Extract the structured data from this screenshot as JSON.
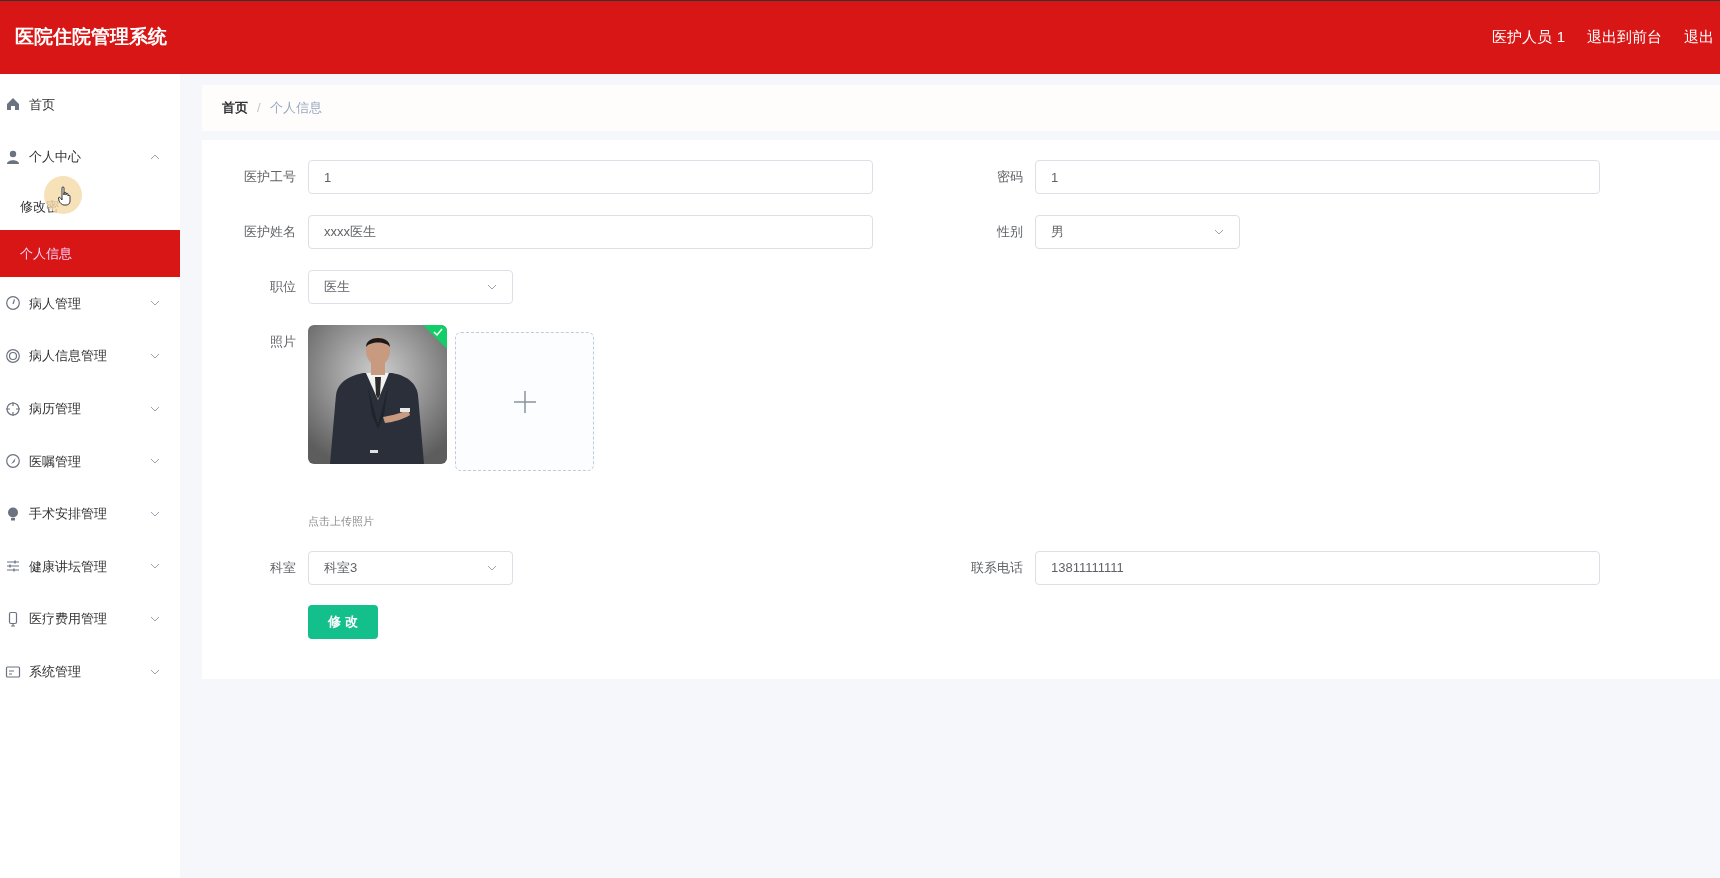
{
  "header": {
    "title": "医院住院管理系统",
    "links": [
      "医护人员 1",
      "退出到前台",
      "退出"
    ]
  },
  "sidebar": {
    "items": [
      {
        "label": "首页"
      },
      {
        "label": "个人中心",
        "expanded": true,
        "children": [
          {
            "label": "修改密",
            "selected": false
          },
          {
            "label": "个人信息",
            "selected": true
          }
        ]
      },
      {
        "label": "病人管理",
        "expanded": false
      },
      {
        "label": "病人信息管理",
        "expanded": false
      },
      {
        "label": "病历管理",
        "expanded": false
      },
      {
        "label": "医嘱管理",
        "expanded": false
      },
      {
        "label": "手术安排管理",
        "expanded": false
      },
      {
        "label": "健康讲坛管理",
        "expanded": false
      },
      {
        "label": "医疗费用管理",
        "expanded": false
      },
      {
        "label": "系统管理",
        "expanded": false
      }
    ]
  },
  "breadcrumb": {
    "items": [
      "首页",
      "个人信息"
    ],
    "separator": "/"
  },
  "form": {
    "rows": [
      [
        {
          "kind": "input",
          "label": "医护工号",
          "value": "1"
        },
        {
          "kind": "input",
          "label": "密码",
          "value": "1"
        }
      ],
      [
        {
          "kind": "input",
          "label": "医护姓名",
          "value": "xxxx医生"
        },
        {
          "kind": "select",
          "label": "性别",
          "value": "男"
        }
      ],
      [
        {
          "kind": "select",
          "label": "职位",
          "value": "医生"
        }
      ],
      [
        {
          "kind": "upload",
          "label": "照片",
          "uploaded": true,
          "hint": "点击上传照片"
        }
      ],
      [
        {
          "kind": "select",
          "label": "科室",
          "value": "科室3"
        },
        {
          "kind": "input",
          "label": "联系电话",
          "value": "13811111111"
        }
      ]
    ],
    "submit": "修 改"
  }
}
